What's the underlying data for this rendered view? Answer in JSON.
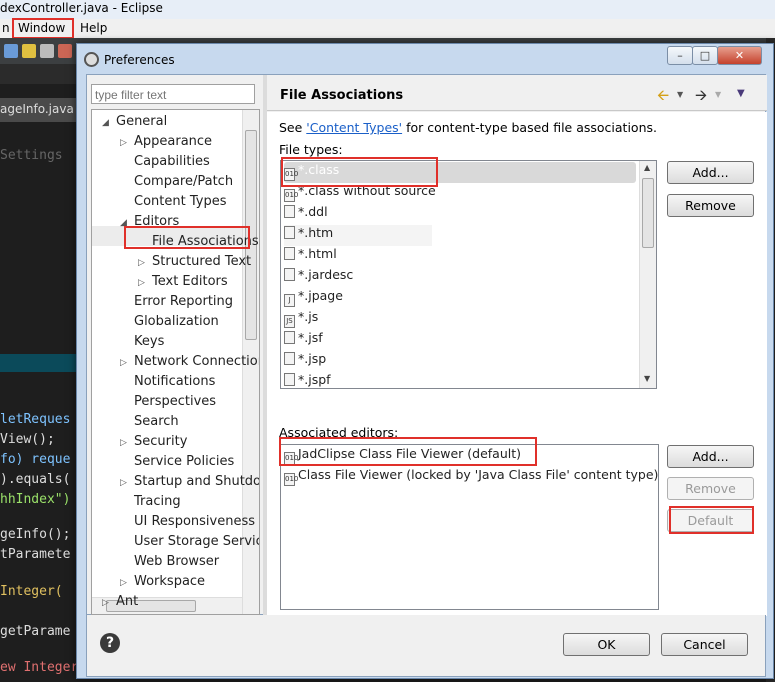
{
  "window": {
    "title": "dexController.java - Eclipse",
    "menu": {
      "partial_left": "n",
      "window": "Window",
      "help": "Help"
    }
  },
  "editor": {
    "tab_label": "ageInfo.java",
    "lines": [
      {
        "text": "Settings",
        "color": "#666666"
      },
      {
        "text": "letReques",
        "color": "#7ec3ff"
      },
      {
        "text": "View();",
        "color": "#dddddd"
      },
      {
        "text": "fo) reque",
        "color": "#7ec3ff"
      },
      {
        "text": ").equals(",
        "color": "#dddddd"
      },
      {
        "text": "hhIndex\")",
        "color": "#9be26a"
      },
      {
        "text": "geInfo();",
        "color": "#dddddd"
      },
      {
        "text": "tParamete",
        "color": "#dddddd"
      },
      {
        "text": " Integer(",
        "color": "#e0c060"
      },
      {
        "text": "getParame",
        "color": "#dddddd"
      },
      {
        "text": "ew Integer",
        "color": "#e07070"
      }
    ]
  },
  "dialog": {
    "title": "Preferences",
    "buttons": {
      "minimize": "–",
      "maximize": "□",
      "close": "✕"
    },
    "filter_placeholder": "type filter text",
    "tree": [
      {
        "label": "General",
        "expanded": true,
        "level": 0
      },
      {
        "label": "Appearance",
        "twisty": "collapsed",
        "level": 1
      },
      {
        "label": "Capabilities",
        "level": 1
      },
      {
        "label": "Compare/Patch",
        "level": 1
      },
      {
        "label": "Content Types",
        "level": 1
      },
      {
        "label": "Editors",
        "twisty": "expanded",
        "level": 1
      },
      {
        "label": "File Associations",
        "level": 2,
        "selected": true
      },
      {
        "label": "Structured Text",
        "twisty": "collapsed",
        "level": 2
      },
      {
        "label": "Text Editors",
        "twisty": "collapsed",
        "level": 2
      },
      {
        "label": "Error Reporting",
        "level": 1
      },
      {
        "label": "Globalization",
        "level": 1
      },
      {
        "label": "Keys",
        "level": 1
      },
      {
        "label": "Network Connections",
        "twisty": "collapsed",
        "level": 1
      },
      {
        "label": "Notifications",
        "level": 1
      },
      {
        "label": "Perspectives",
        "level": 1
      },
      {
        "label": "Search",
        "level": 1
      },
      {
        "label": "Security",
        "twisty": "collapsed",
        "level": 1
      },
      {
        "label": "Service Policies",
        "level": 1
      },
      {
        "label": "Startup and Shutdown",
        "twisty": "collapsed",
        "level": 1
      },
      {
        "label": "Tracing",
        "level": 1
      },
      {
        "label": "UI Responsiveness",
        "level": 1
      },
      {
        "label": "User Storage Service",
        "level": 1
      },
      {
        "label": "Web Browser",
        "level": 1
      },
      {
        "label": "Workspace",
        "twisty": "collapsed",
        "level": 1
      },
      {
        "label": "Ant",
        "twisty": "collapsed",
        "level": 0
      }
    ],
    "page": {
      "title": "File Associations",
      "see_prefix": "See ",
      "see_link": "'Content Types'",
      "see_suffix": " for content-type based file associations.",
      "file_types_label": "File types:",
      "file_types": [
        "*.class",
        "*.class without source",
        "*.ddl",
        "*.htm",
        "*.html",
        "*.jardesc",
        "*.jpage",
        "*.js",
        "*.jsf",
        "*.jsp",
        "*.jspf"
      ],
      "file_type_icons": [
        "class-icon",
        "class-icon",
        "ddl-icon",
        "html-icon",
        "html-icon",
        "jar-icon",
        "jpage-icon",
        "js-icon",
        "file-icon",
        "file-icon",
        "file-icon"
      ],
      "ft_add": "Add...",
      "ft_remove": "Remove",
      "associated_editors_label": "Associated editors:",
      "editors": [
        "JadClipse Class File Viewer (default)",
        "Class File Viewer (locked by 'Java Class File' content type)"
      ],
      "ed_add": "Add...",
      "ed_remove": "Remove",
      "ed_default": "Default"
    },
    "footer": {
      "help": "?",
      "ok": "OK",
      "cancel": "Cancel"
    }
  },
  "colors": {
    "highlight_red": "#e0302a",
    "link": "#1a5fc8",
    "dialog_frame": "#c7d9ee"
  }
}
